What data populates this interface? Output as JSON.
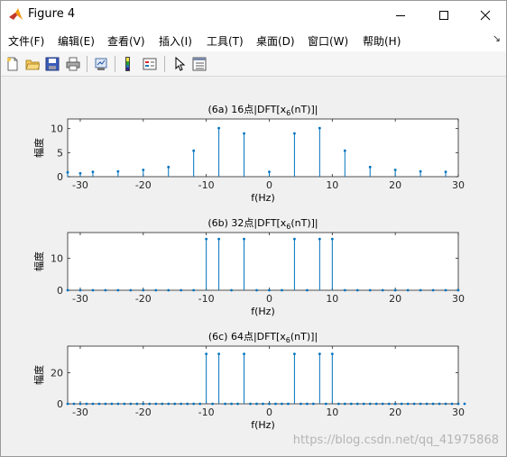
{
  "window": {
    "title": "Figure 4",
    "controls": [
      "minimize",
      "maximize",
      "close"
    ]
  },
  "menu": {
    "items": [
      "文件(F)",
      "编辑(E)",
      "查看(V)",
      "插入(I)",
      "工具(T)",
      "桌面(D)",
      "窗口(W)",
      "帮助(H)"
    ],
    "overflow_glyph": "↘"
  },
  "toolbar": {
    "icons": [
      "new-figure-icon",
      "open-file-icon",
      "save-icon",
      "print-icon",
      "link-plot-icon",
      "colorbar-icon",
      "legend-icon",
      "pointer-icon",
      "property-inspector-icon"
    ]
  },
  "colors": {
    "stem": "#0072bd",
    "axes_bg": "#ffffff",
    "figure_bg": "#f0f0f0"
  },
  "watermark": "https://blog.csdn.net/qq_41975868",
  "chart_data": [
    {
      "type": "stem",
      "title": "(6a) 16点|DFT[x",
      "title_sub": "6",
      "title_tail": "(nT)]|",
      "xlabel": "f(Hz)",
      "ylabel": "幅度",
      "xlim": [
        -32,
        30
      ],
      "ylim": [
        0,
        12
      ],
      "xticks": [
        -30,
        -20,
        -10,
        0,
        10,
        20,
        30
      ],
      "yticks": [
        0,
        5,
        10
      ],
      "x": [
        -32,
        -30,
        -28,
        -24,
        -20,
        -16,
        -12,
        -8,
        -4,
        0,
        4,
        8,
        12,
        16,
        20,
        24,
        28
      ],
      "y": [
        0.9,
        0.7,
        1.0,
        1.1,
        1.4,
        2.0,
        5.4,
        10.1,
        9.0,
        1.0,
        9.0,
        10.1,
        5.4,
        2.0,
        1.4,
        1.1,
        1.0
      ]
    },
    {
      "type": "stem",
      "title": "(6b) 32点|DFT[x",
      "title_sub": "6",
      "title_tail": "(nT)]|",
      "xlabel": "f(Hz)",
      "ylabel": "幅度",
      "xlim": [
        -32,
        30
      ],
      "ylim": [
        0,
        18
      ],
      "xticks": [
        -30,
        -20,
        -10,
        0,
        10,
        20,
        30
      ],
      "yticks": [
        0,
        10
      ],
      "x": [
        -32,
        -30,
        -28,
        -26,
        -24,
        -22,
        -20,
        -18,
        -16,
        -14,
        -12,
        -10,
        -8,
        -6,
        -4,
        -2,
        0,
        2,
        4,
        6,
        8,
        10,
        12,
        14,
        16,
        18,
        20,
        22,
        24,
        26,
        28,
        30
      ],
      "y": [
        0,
        0,
        0,
        0,
        0,
        0,
        0,
        0,
        0,
        0,
        0,
        16,
        16,
        0,
        16,
        0,
        0,
        0,
        16,
        0,
        16,
        16,
        0,
        0,
        0,
        0,
        0,
        0,
        0,
        0,
        0,
        0
      ]
    },
    {
      "type": "stem",
      "title": "(6c) 64点|DFT[x",
      "title_sub": "6",
      "title_tail": "(nT)]|",
      "xlabel": "f(Hz)",
      "ylabel": "幅度",
      "xlim": [
        -32,
        30
      ],
      "ylim": [
        0,
        37
      ],
      "xticks": [
        -30,
        -20,
        -10,
        0,
        10,
        20,
        30
      ],
      "yticks": [
        0,
        20
      ],
      "x_step": 1,
      "x_range": [
        -32,
        31
      ],
      "nonzero": {
        "-10": 32,
        "-8": 32,
        "-4": 32,
        "4": 32,
        "8": 32,
        "10": 32
      }
    }
  ]
}
